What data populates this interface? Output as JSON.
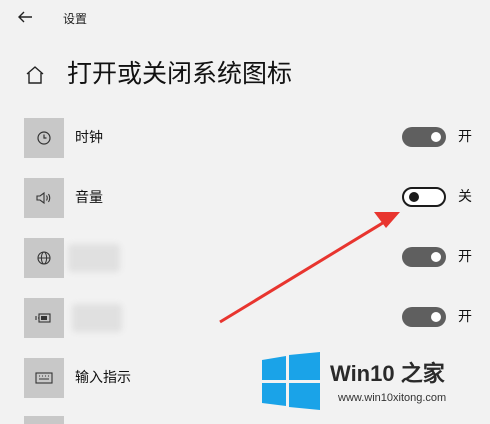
{
  "header": {
    "back_label": "←",
    "title": "设置"
  },
  "page": {
    "title": "打开或关闭系统图标"
  },
  "items": [
    {
      "label": "时钟",
      "icon": "clock-icon",
      "state": "开",
      "on": true
    },
    {
      "label": "音量",
      "icon": "speaker-icon",
      "state": "关",
      "on": false
    },
    {
      "label": "",
      "icon": "globe-icon",
      "state": "开",
      "on": true
    },
    {
      "label": "",
      "icon": "battery-icon",
      "state": "开",
      "on": true
    },
    {
      "label": "输入指示",
      "icon": "keyboard-icon",
      "state": "",
      "on": null
    }
  ],
  "watermark": {
    "brand": "Win10 之家",
    "url": "www.win10xitong.com"
  },
  "colors": {
    "accent_arrow": "#e8352f",
    "tile_bg": "#c8c8c8",
    "toggle_on": "#5f5f5f",
    "logo_blue": "#1aa3e8"
  }
}
